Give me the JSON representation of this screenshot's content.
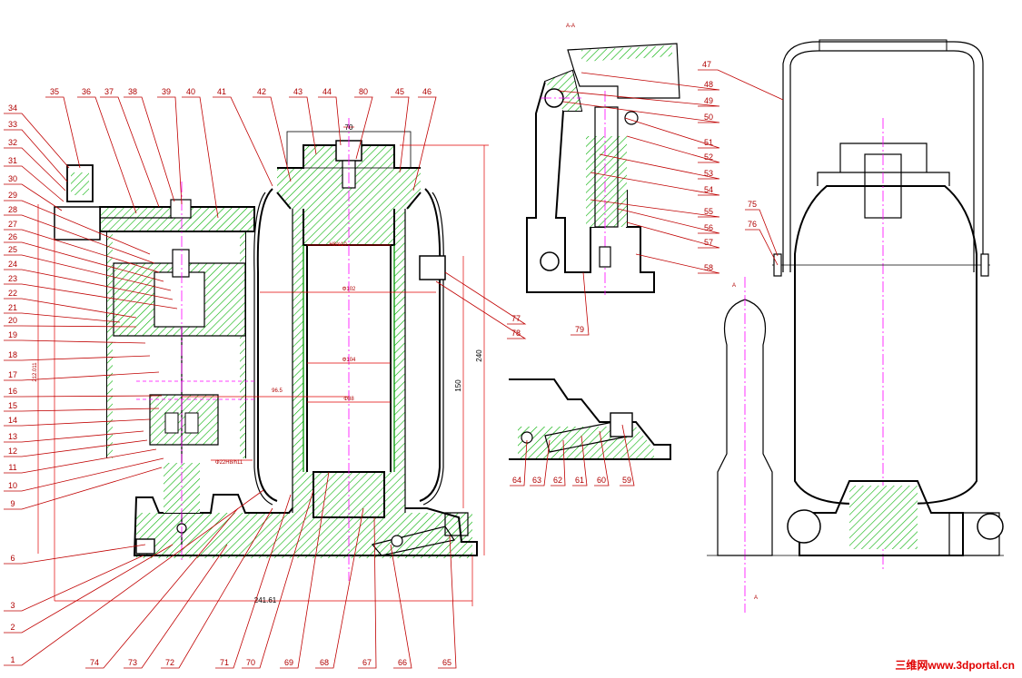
{
  "watermark": "三维网www.3dportal.cn",
  "section_labels": {
    "top": "A-A",
    "right_top": "A",
    "right_bottom": "A"
  },
  "dims": {
    "d70": "70",
    "h240": "240",
    "h150": "150",
    "w241": "241.61",
    "v212": "212.011",
    "fit1": "H8/e10",
    "phi102": "Φ102",
    "phi104": "Φ104",
    "phi88": "Φ88",
    "d965": "96.5",
    "fit2": "Φ22H8/h11"
  },
  "labels_top": [
    "35",
    "36",
    "37",
    "38",
    "39",
    "40",
    "41",
    "42",
    "43",
    "44",
    "80",
    "45",
    "46"
  ],
  "labels_left": [
    "34",
    "33",
    "32",
    "31",
    "30",
    "29",
    "28",
    "27",
    "26",
    "25",
    "24",
    "23",
    "22",
    "21",
    "20",
    "19",
    "18",
    "17",
    "16",
    "15",
    "14",
    "13",
    "12",
    "11",
    "10",
    "9",
    "6",
    "3",
    "2",
    "1"
  ],
  "labels_bottom": [
    "74",
    "73",
    "72",
    "71",
    "70",
    "69",
    "68",
    "67",
    "66",
    "65"
  ],
  "labels_mid": [
    "77",
    "78"
  ],
  "labels_right_top": [
    "48",
    "49",
    "50",
    "51",
    "52",
    "53",
    "54",
    "55",
    "56",
    "57",
    "58",
    "79"
  ],
  "labels_detail": [
    "64",
    "63",
    "62",
    "61",
    "60",
    "59"
  ],
  "labels_right_view": [
    "47",
    "75",
    "76"
  ]
}
